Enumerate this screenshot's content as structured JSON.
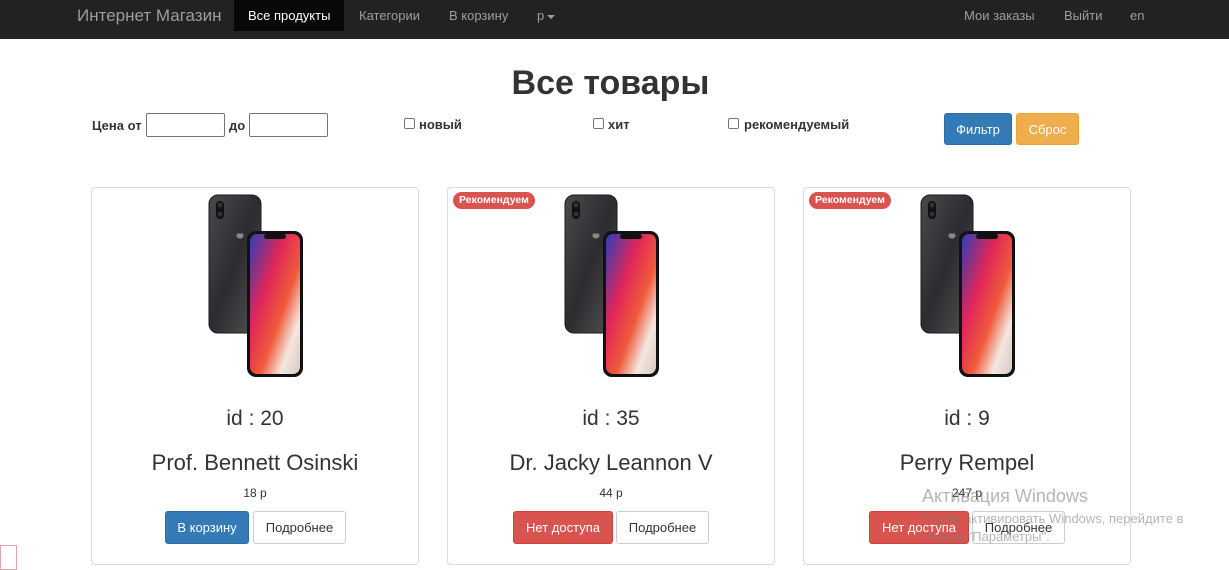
{
  "navbar": {
    "brand": "Интернет Магазин",
    "items": [
      {
        "label": "Все продукты",
        "active": true
      },
      {
        "label": "Категории"
      },
      {
        "label": "В корзину"
      },
      {
        "label": "р",
        "dropdown": true
      }
    ],
    "right_items": [
      {
        "label": "Мои заказы"
      },
      {
        "label": "Выйти"
      },
      {
        "label": "en"
      }
    ]
  },
  "page_title": "Все товары",
  "filter": {
    "price_from_label": "Цена от",
    "price_to_label": "до",
    "price_from_value": "",
    "price_to_value": "",
    "checkboxes": [
      {
        "label": "новый",
        "checked": false
      },
      {
        "label": "хит",
        "checked": false
      },
      {
        "label": "рекомендуемый",
        "checked": false
      }
    ],
    "filter_button": "Фильтр",
    "reset_button": "Сброс"
  },
  "products": [
    {
      "badge": "",
      "id_text": "id : 20",
      "name": "Prof. Bennett Osinski",
      "price": "18 р",
      "primary_button": "В корзину",
      "primary_type": "cart",
      "details_button": "Подробнее"
    },
    {
      "badge": "Рекомендуем",
      "id_text": "id : 35",
      "name": "Dr. Jacky Leannon V",
      "price": "44 р",
      "primary_button": "Нет доступа",
      "primary_type": "unavailable",
      "details_button": "Подробнее"
    },
    {
      "badge": "Рекомендуем",
      "id_text": "id : 9",
      "name": "Perry Rempel",
      "price": "247 р",
      "primary_button": "Нет доступа",
      "primary_type": "unavailable",
      "details_button": "Подробнее"
    }
  ],
  "watermark": {
    "title": "Активация Windows",
    "text": "Чтобы активировать Windows, перейдите в раздел \"Параметры\"."
  },
  "colors": {
    "navbar_bg": "#222222",
    "primary": "#337ab7",
    "warning": "#f0ad4e",
    "danger": "#d9534f"
  }
}
